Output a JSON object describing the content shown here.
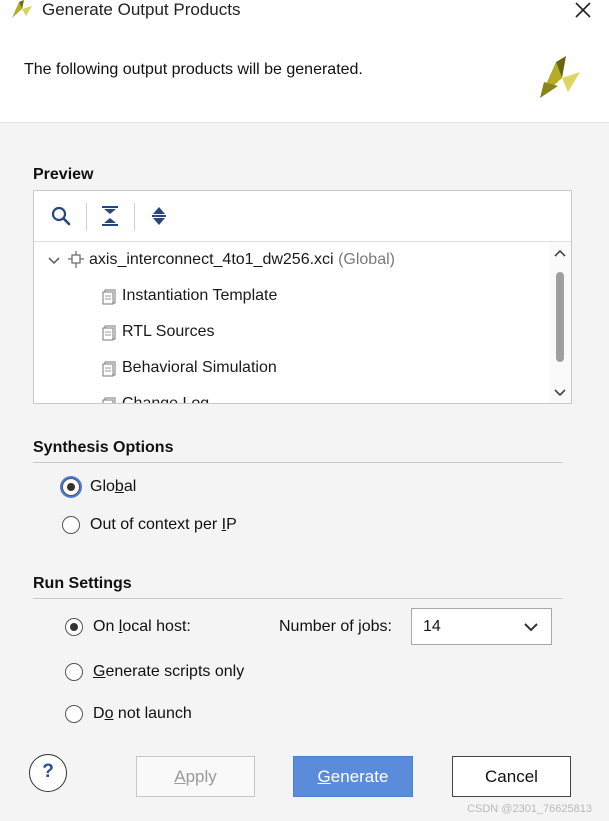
{
  "window": {
    "title": "Generate Output Products"
  },
  "banner": {
    "message": "The following output products will be generated."
  },
  "preview": {
    "title": "Preview",
    "tree": {
      "root": {
        "name": "axis_interconnect_4to1_dw256.xci",
        "scope": "(Global)"
      },
      "children": [
        "Instantiation Template",
        "RTL Sources",
        "Behavioral Simulation",
        "Change Log"
      ]
    }
  },
  "synthesis": {
    "title": "Synthesis Options",
    "options": [
      {
        "pre": "Glo",
        "mnemonic": "b",
        "post": "al",
        "checked": true
      },
      {
        "pre": "Out of context per ",
        "mnemonic": "I",
        "post": "P",
        "checked": false
      }
    ]
  },
  "run": {
    "title": "Run Settings",
    "options": [
      {
        "pre": "On ",
        "mnemonic": "l",
        "post": "ocal host:",
        "checked": true
      },
      {
        "pre": "",
        "mnemonic": "G",
        "post": "enerate scripts only",
        "checked": false
      },
      {
        "pre": "D",
        "mnemonic": "o",
        "post": " not launch",
        "checked": false
      }
    ],
    "jobs_label": "Number of jobs:",
    "jobs_value": "14"
  },
  "buttons": {
    "help": "?",
    "apply": {
      "mnemonic": "A",
      "rest": "pply"
    },
    "generate": {
      "mnemonic": "G",
      "rest": "enerate"
    },
    "cancel": "Cancel"
  },
  "watermark": "CSDN @2301_76625813",
  "colors": {
    "accent": "#5b8cdb",
    "logo_yellow": "#c8c23a",
    "logo_dark": "#7a7a1a"
  }
}
